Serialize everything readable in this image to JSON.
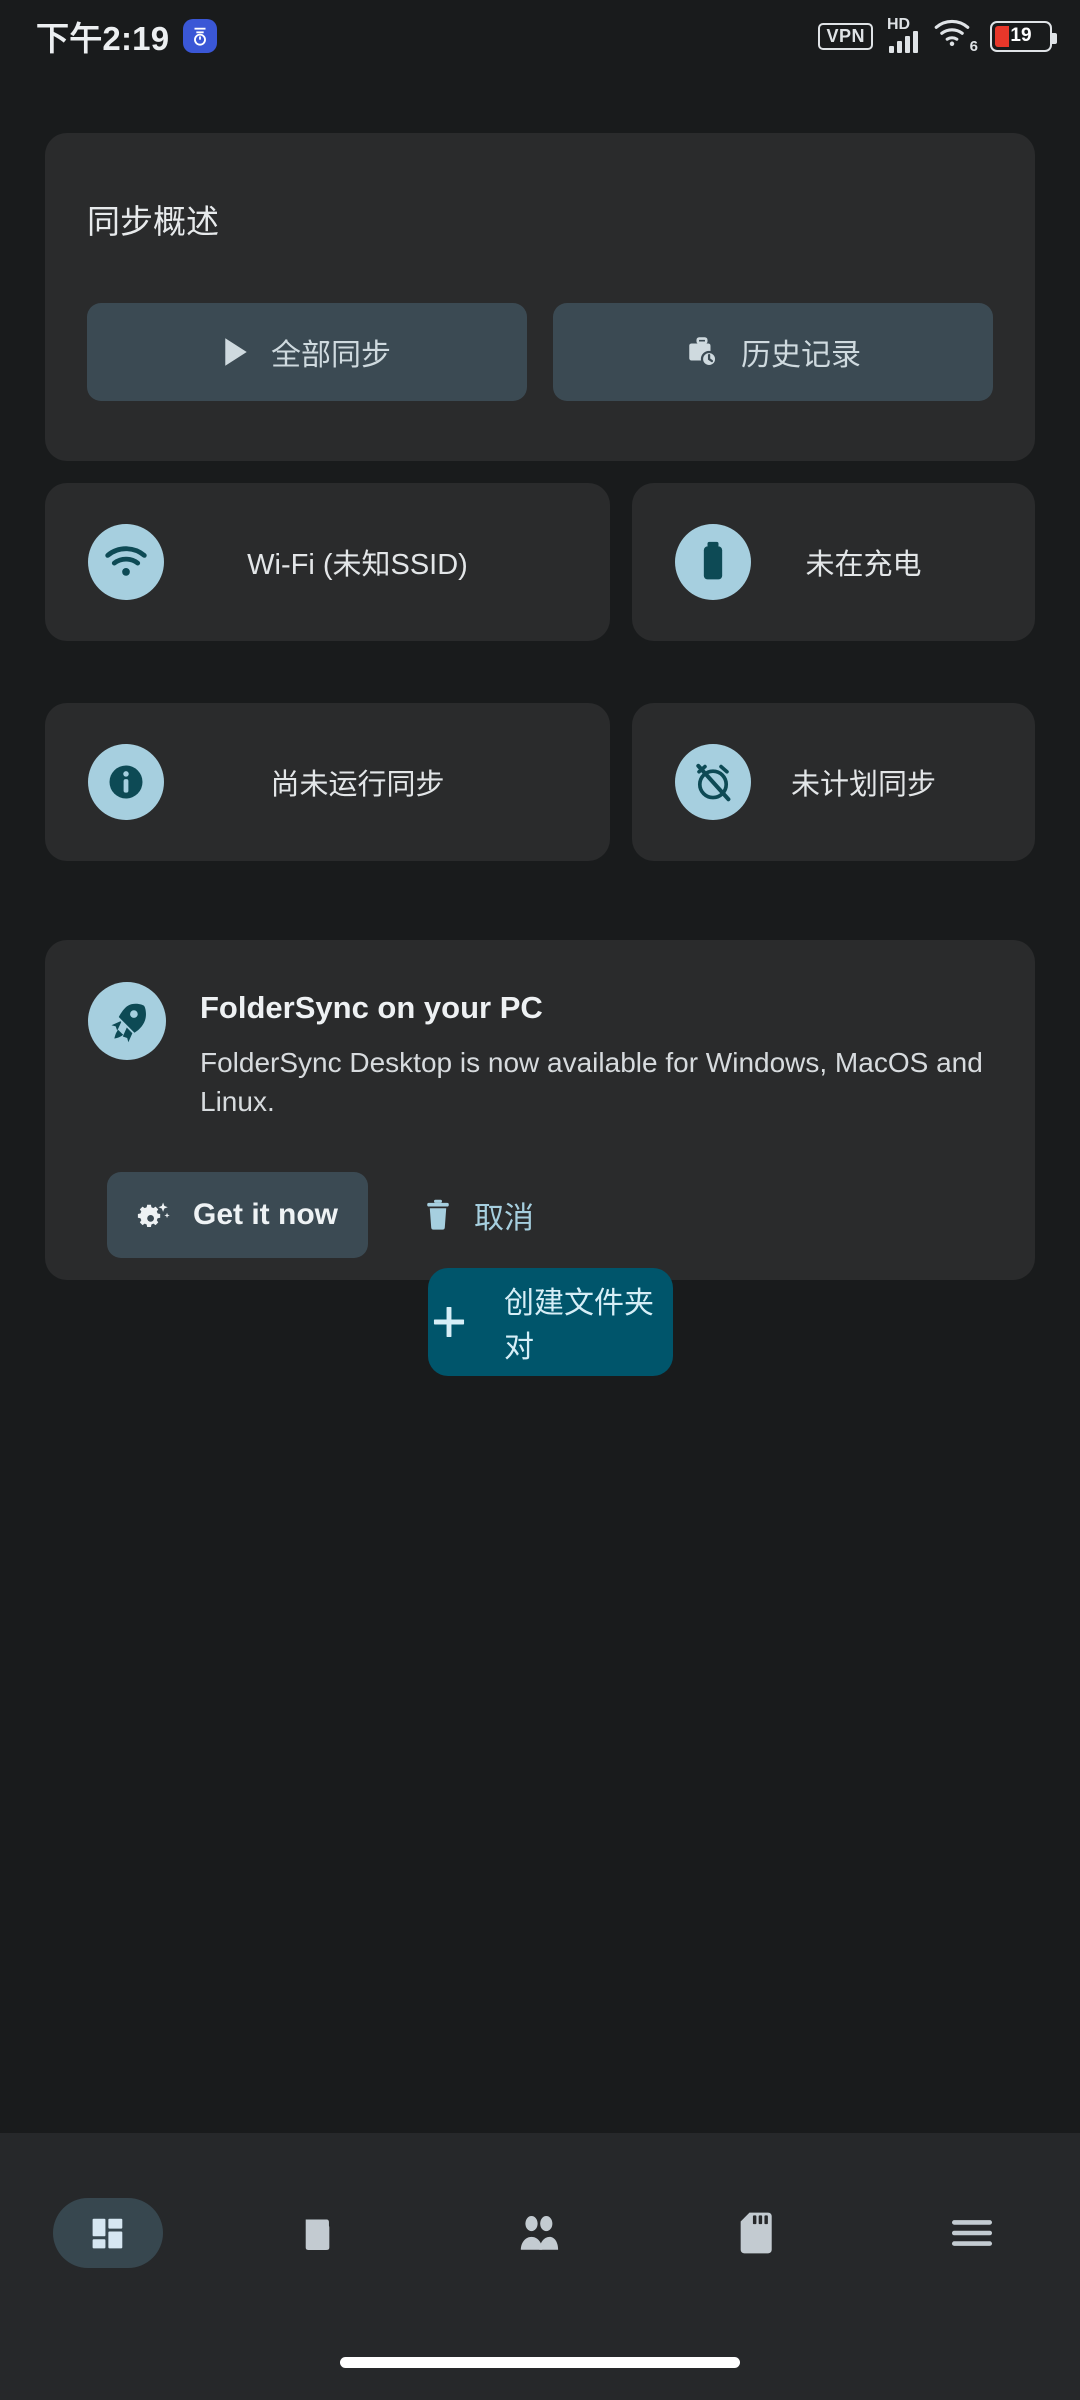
{
  "status_bar": {
    "time": "下午2:19",
    "notification_badge_icon": "timer-badge-icon",
    "vpn_label": "VPN",
    "network_type": "HD",
    "wifi_generation": "6",
    "battery_level": "19",
    "battery_color": "#e8372a"
  },
  "overview_card": {
    "title": "同步概述",
    "sync_all_label": "全部同步",
    "sync_all_icon": "play-icon",
    "history_label": "历史记录",
    "history_icon": "briefcase-clock-icon"
  },
  "status_tiles": [
    {
      "id": "wifi",
      "icon": "wifi-icon",
      "label": "Wi-Fi (未知SSID)"
    },
    {
      "id": "charge",
      "icon": "battery-icon",
      "label": "未在充电"
    },
    {
      "id": "lastrun",
      "icon": "info-icon",
      "label": "尚未运行同步"
    },
    {
      "id": "sched",
      "icon": "alarm-off-icon",
      "label": "未计划同步"
    }
  ],
  "promo_card": {
    "icon": "rocket-icon",
    "title": "FolderSync on your PC",
    "body": "FolderSync Desktop is now available for Windows, MacOS and Linux.",
    "primary_label": "Get it now",
    "primary_icon": "gear-sparkle-icon",
    "dismiss_label": "取消",
    "dismiss_icon": "trash-icon"
  },
  "fab": {
    "label": "创建文件夹对",
    "icon": "plus-icon",
    "color": "#00556b"
  },
  "bottom_nav": [
    {
      "id": "dashboard",
      "icon": "dashboard-icon",
      "active": true
    },
    {
      "id": "folderpairs",
      "icon": "folder-icon",
      "active": false
    },
    {
      "id": "accounts",
      "icon": "people-icon",
      "active": false
    },
    {
      "id": "storage",
      "icon": "sdcard-icon",
      "active": false
    },
    {
      "id": "more",
      "icon": "hamburger-icon",
      "active": false
    }
  ],
  "theme": {
    "page_bg": "#191b1c",
    "card_bg": "#2a2b2c",
    "button_bg": "#3b4a53",
    "accent_light": "#a6cfdf",
    "accent_dark": "#0d4a55",
    "navbar_bg": "#26282a"
  }
}
